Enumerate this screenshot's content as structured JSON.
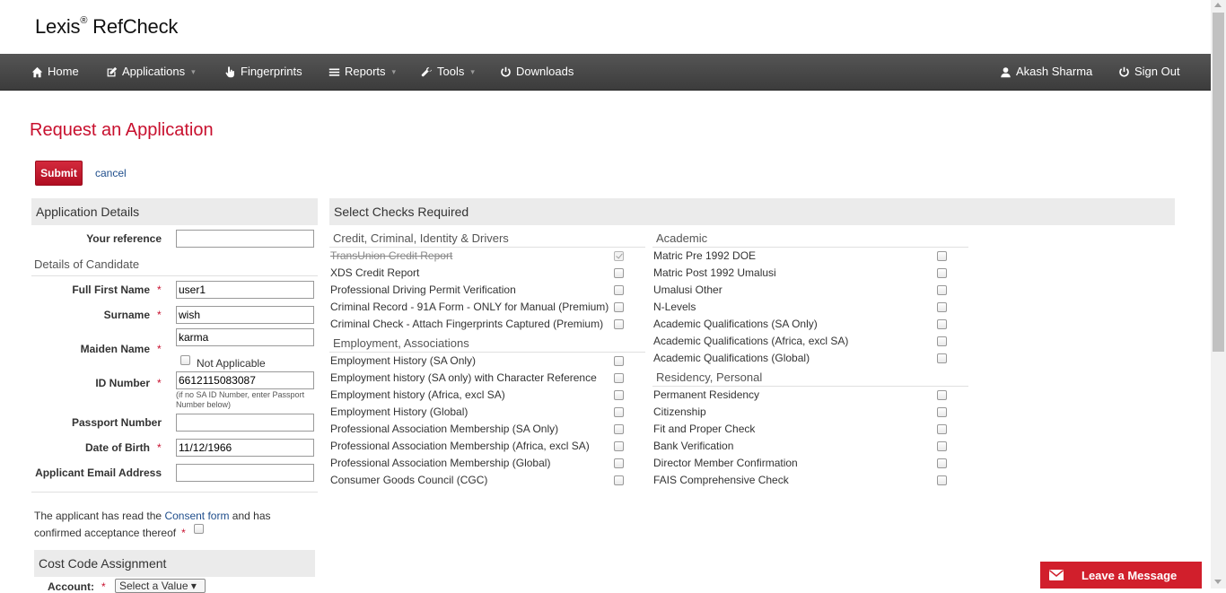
{
  "app": {
    "brand": "Lexis",
    "brand_mark": "®",
    "brand_suffix": " RefCheck"
  },
  "nav": {
    "home": "Home",
    "applications": "Applications",
    "fingerprints": "Fingerprints",
    "reports": "Reports",
    "tools": "Tools",
    "downloads": "Downloads",
    "user": "Akash Sharma",
    "sign_out": "Sign Out",
    "caret": "▾"
  },
  "page": {
    "title": "Request an Application",
    "submit": "Submit",
    "cancel": "cancel"
  },
  "application_details": {
    "heading": "Application Details",
    "your_reference_label": "Your reference",
    "your_reference_value": "",
    "candidate_heading": "Details of Candidate",
    "first_name_label": "Full First Name",
    "first_name_value": "user1",
    "surname_label": "Surname",
    "surname_value": "wish",
    "maiden_label": "Maiden Name",
    "maiden_value": "karma",
    "not_applicable": "Not Applicable",
    "id_label": "ID Number",
    "id_value": "6612115083087",
    "id_hint": "(if no SA ID Number, enter Passport Number below)",
    "passport_label": "Passport Number",
    "passport_value": "",
    "dob_label": "Date of Birth",
    "dob_value": "11/12/1966",
    "email_label": "Applicant Email Address",
    "email_value": "",
    "required_mark": "*",
    "consent_pre": "The applicant has read the ",
    "consent_link": "Consent form",
    "consent_post": " and has",
    "consent_line2": "confirmed acceptance thereof"
  },
  "cost_code": {
    "heading": "Cost Code Assignment",
    "account_label": "Account:",
    "account_value": "Select a Value"
  },
  "checks": {
    "heading": "Select Checks Required",
    "credit_heading": "Credit, Criminal, Identity & Drivers",
    "credit": [
      {
        "label": "TransUnion Credit Report",
        "checked": true,
        "disabled": true
      },
      {
        "label": "XDS Credit Report",
        "checked": false
      },
      {
        "label": "Professional Driving Permit Verification",
        "checked": false
      },
      {
        "label": "Criminal Record - 91A Form - ONLY for Manual (Premium)",
        "checked": false
      },
      {
        "label": "Criminal Check - Attach Fingerprints Captured (Premium)",
        "checked": false
      }
    ],
    "employment_heading": "Employment, Associations",
    "employment": [
      {
        "label": "Employment History (SA Only)",
        "checked": false
      },
      {
        "label": "Employment history (SA only) with Character Reference",
        "checked": false
      },
      {
        "label": "Employment history (Africa, excl SA)",
        "checked": false
      },
      {
        "label": "Employment History (Global)",
        "checked": false
      },
      {
        "label": "Professional Association Membership (SA Only)",
        "checked": false
      },
      {
        "label": "Professional Association Membership (Africa, excl SA)",
        "checked": false
      },
      {
        "label": "Professional Association Membership (Global)",
        "checked": false
      },
      {
        "label": "Consumer Goods Council (CGC)",
        "checked": false
      }
    ],
    "academic_heading": "Academic",
    "academic": [
      {
        "label": "Matric Pre 1992 DOE",
        "checked": false
      },
      {
        "label": "Matric Post 1992 Umalusi",
        "checked": false
      },
      {
        "label": "Umalusi Other",
        "checked": false
      },
      {
        "label": "N-Levels",
        "checked": false
      },
      {
        "label": "Academic Qualifications (SA Only)",
        "checked": false
      },
      {
        "label": "Academic Qualifications (Africa, excl SA)",
        "checked": false
      },
      {
        "label": "Academic Qualifications (Global)",
        "checked": false
      }
    ],
    "residency_heading": "Residency, Personal",
    "residency": [
      {
        "label": "Permanent Residency",
        "checked": false
      },
      {
        "label": "Citizenship",
        "checked": false
      },
      {
        "label": "Fit and Proper Check",
        "checked": false
      },
      {
        "label": "Bank Verification",
        "checked": false
      },
      {
        "label": "Director Member Confirmation",
        "checked": false
      },
      {
        "label": "FAIS Comprehensive Check",
        "checked": false
      }
    ]
  },
  "chat": {
    "label": "Leave a Message"
  },
  "colors": {
    "brand_red": "#c8102e",
    "nav_dark": "#444444",
    "link_blue": "#1f4e8c",
    "panel_grey": "#ebebeb"
  }
}
